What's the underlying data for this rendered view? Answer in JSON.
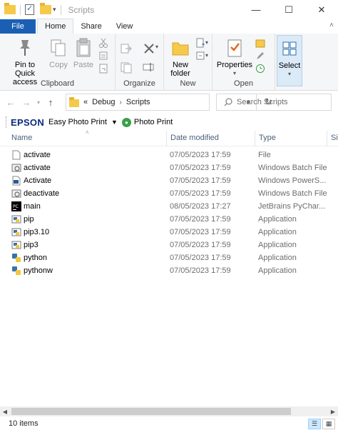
{
  "window": {
    "title": "Scripts"
  },
  "ribbon": {
    "tabs": [
      {
        "label": "File"
      },
      {
        "label": "Home"
      },
      {
        "label": "Share"
      },
      {
        "label": "View"
      }
    ],
    "clipboard": {
      "label": "Clipboard",
      "pin_label_1": "Pin to Quick",
      "pin_label_2": "access",
      "copy_label": "Copy",
      "paste_label": "Paste"
    },
    "organize": {
      "label": "Organize"
    },
    "new": {
      "label": "New",
      "new_folder_1": "New",
      "new_folder_2": "folder"
    },
    "open": {
      "label": "Open",
      "properties_label": "Properties"
    },
    "select": {
      "label": "Select"
    }
  },
  "address": {
    "crumbs": [
      "Debug",
      "Scripts"
    ],
    "overflow": "«"
  },
  "search": {
    "placeholder": "Search Scripts"
  },
  "epson_toolbar": {
    "brand": "EPSON",
    "easy_photo_print": "Easy Photo Print",
    "photo_print": "Photo Print"
  },
  "columns": {
    "name": "Name",
    "date": "Date modified",
    "type": "Type",
    "size": "Si"
  },
  "files": [
    {
      "name": "activate",
      "date": "07/05/2023 17:59",
      "type": "File",
      "icon": "blank-file-icon"
    },
    {
      "name": "activate",
      "date": "07/05/2023 17:59",
      "type": "Windows Batch File",
      "icon": "batch-file-icon"
    },
    {
      "name": "Activate",
      "date": "07/05/2023 17:59",
      "type": "Windows PowerS...",
      "icon": "powershell-file-icon"
    },
    {
      "name": "deactivate",
      "date": "07/05/2023 17:59",
      "type": "Windows Batch File",
      "icon": "batch-file-icon"
    },
    {
      "name": "main",
      "date": "08/05/2023 17:27",
      "type": "JetBrains PyChar...",
      "icon": "pycharm-icon"
    },
    {
      "name": "pip",
      "date": "07/05/2023 17:59",
      "type": "Application",
      "icon": "python-app-icon"
    },
    {
      "name": "pip3.10",
      "date": "07/05/2023 17:59",
      "type": "Application",
      "icon": "python-app-icon"
    },
    {
      "name": "pip3",
      "date": "07/05/2023 17:59",
      "type": "Application",
      "icon": "python-app-icon"
    },
    {
      "name": "python",
      "date": "07/05/2023 17:59",
      "type": "Application",
      "icon": "python-icon"
    },
    {
      "name": "pythonw",
      "date": "07/05/2023 17:59",
      "type": "Application",
      "icon": "python-icon"
    }
  ],
  "status": {
    "item_count": "10 items"
  },
  "colors": {
    "accent": "#1a5fb4",
    "folder": "#f5c94a",
    "epson": "#0a2a7a"
  }
}
